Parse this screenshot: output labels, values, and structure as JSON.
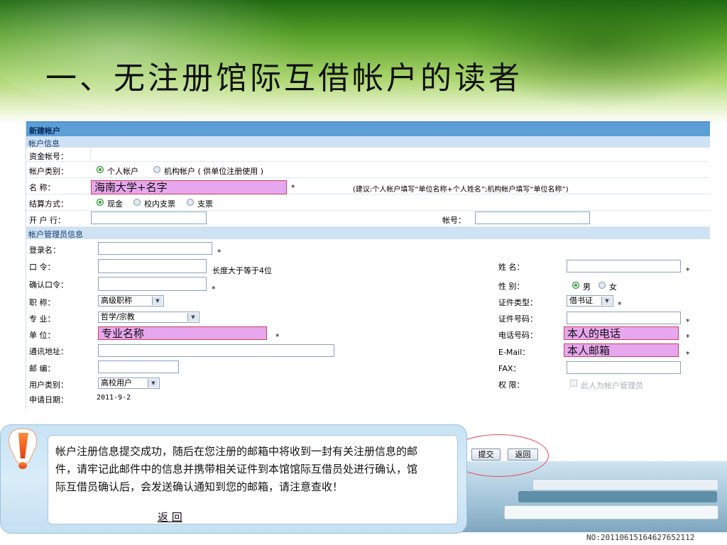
{
  "slide": {
    "title": "一、无注册馆际互借帐户的读者",
    "slide_id": "NO:201106151646276521​12"
  },
  "form": {
    "header": "新建帐户",
    "section_account": "帐户信息",
    "fund_no": {
      "label": "资金帐号："
    },
    "account_type": {
      "label": "帐户类别：",
      "opt1": "个人帐户",
      "opt2": "机构帐户 ( 供单位注册使用 )"
    },
    "name": {
      "label": "名  称：",
      "value": "海南大学+名字",
      "hint": "(建议:个人帐户填写“单位名称+个人姓名”;机构帐户填写“单位名称”)"
    },
    "settle": {
      "label": "结算方式：",
      "opt1": "现金",
      "opt2": "校内支票",
      "opt3": "支票"
    },
    "bank": {
      "label": "开 户 行：",
      "acct_label": "帐号："
    },
    "section_admin": "帐户管理员信息",
    "login": {
      "label": "登录名："
    },
    "password": {
      "label": "口  令：",
      "hint": "长度大于等于4位"
    },
    "confirm": {
      "label": "确认口令："
    },
    "title_field": {
      "label": "职  称：",
      "value": "高级职称"
    },
    "major": {
      "label": "专  业：",
      "value": "哲学/宗教"
    },
    "unit": {
      "label": "单  位：",
      "value": "专业名称"
    },
    "address": {
      "label": "通讯地址："
    },
    "zip": {
      "label": "邮  编："
    },
    "user_type": {
      "label": "用户类别：",
      "value": "高校用户"
    },
    "apply_date": {
      "label": "申请日期：",
      "value": "2011-9-2"
    },
    "surname": {
      "label": "姓  名："
    },
    "gender": {
      "label": "性  别：",
      "male": "男",
      "female": "女"
    },
    "id_type": {
      "label": "证件类型：",
      "value": "借书证"
    },
    "id_no": {
      "label": "证件号码："
    },
    "phone": {
      "label": "电话号码：",
      "value": "本人的电话"
    },
    "email": {
      "label": "E-Mail：",
      "value": "本人邮箱"
    },
    "fax": {
      "label": "FAX："
    },
    "perm": {
      "label": "权  限：",
      "value": "此人为帐户管理员"
    },
    "required": "*"
  },
  "popup": {
    "message": "帐户注册信息提交成功，随后在您注册的邮箱中将收到一封有关注册信息的邮件，请牢记此邮件中的信息并携带相关证件到本馆馆际互借员处进行确认，馆际互借员确认后，会发送确认通知到您的邮箱，请注意查收！",
    "back": "返 回"
  },
  "buttons": {
    "submit": "提交",
    "back": "返回"
  },
  "colors": {
    "header_bar": "#5b9fd6",
    "section_bar": "#cfe2f4",
    "highlight_fill": "#e6a7ee",
    "highlight_border": "#d0405a"
  },
  "icons": {
    "warning": "exclamation-warning-icon"
  }
}
